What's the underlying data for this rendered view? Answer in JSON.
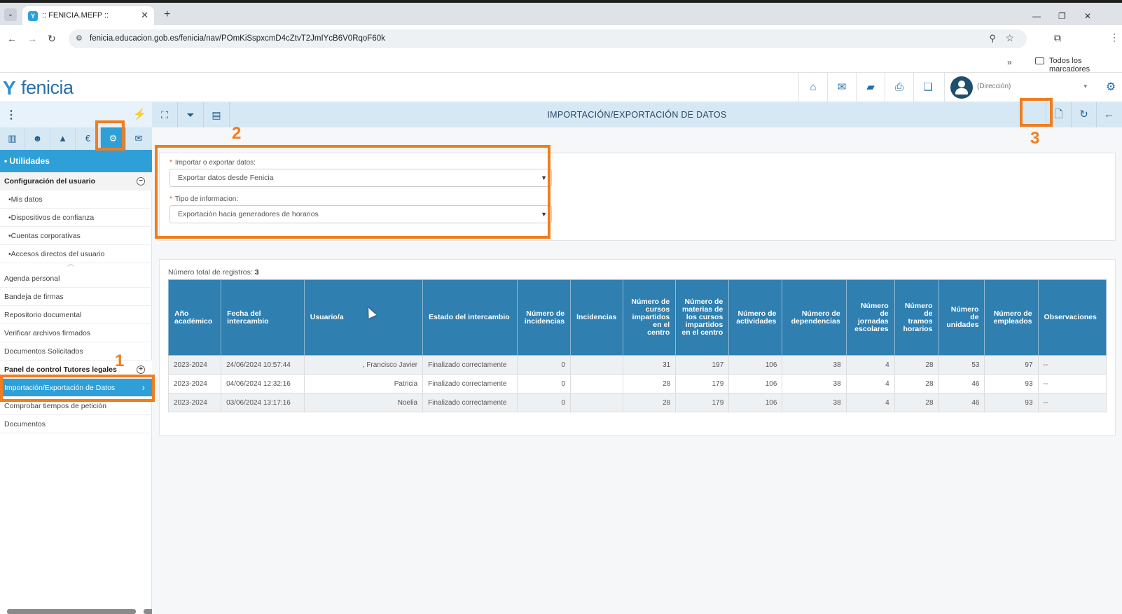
{
  "browser": {
    "tab_title": ":: FENICIA.MEFP ::",
    "tab_close": "✕",
    "new_tab": "+",
    "url": "fenicia.educacion.gob.es/fenicia/nav/POmKiSspxcmD4cZtvT2JmIYcB6V0RqoF60k",
    "bookmarks_more": "»",
    "bookmarks_label": "Todos los marcadores"
  },
  "app": {
    "logo_text": "fenicia",
    "user_name": "(Dirección)",
    "page_title": "IMPORTACIÓN/EXPORTACIÓN DE DATOS"
  },
  "sidebar": {
    "section": "• Utilidades",
    "group": "Configuración del usuario",
    "sub_items": [
      "•Mis datos",
      "•Dispositivos de confianza",
      "•Cuentas corporativas",
      "•Accesos directos del usuario"
    ],
    "items": [
      "Agenda personal",
      "Bandeja de firmas",
      "Repositorio documental",
      "Verificar archivos firmados",
      "Documentos Solicitados"
    ],
    "group2": "Panel de control Tutores legales",
    "selected": "Importación/Exportación de Datos",
    "items_after": [
      "Comprobar tiempos de petición",
      "Documentos"
    ]
  },
  "form": {
    "label1": "Importar o exportar datos:",
    "value1": "Exportar datos desde Fenicia",
    "label2": "Tipo de informacion:",
    "value2": "Exportación hacia generadores de horarios",
    "required_mark": "*"
  },
  "callouts": {
    "c1": "1",
    "c2": "2",
    "c3": "3"
  },
  "table": {
    "total_label": "Número total de registros:",
    "total_value": "3",
    "headers": [
      "Año académico",
      "Fecha del intercambio",
      "Usuario/a",
      "Estado del intercambio",
      "Número de incidencias",
      "Incidencias",
      "Número de cursos impartidos en el centro",
      "Número de materias de los cursos impartidos en el centro",
      "Número de actividades",
      "Número de dependencias",
      "Número de jornadas escolares",
      "Número de tramos horarios",
      "Número de unidades",
      "Número de empleados",
      "Observaciones"
    ],
    "rows": [
      [
        "2023-2024",
        "24/06/2024 10:57:44",
        ", Francisco Javier",
        "Finalizado correctamente",
        "0",
        "",
        "31",
        "197",
        "106",
        "38",
        "4",
        "28",
        "53",
        "97",
        "--"
      ],
      [
        "2023-2024",
        "04/06/2024 12:32:16",
        "Patricia",
        "Finalizado correctamente",
        "0",
        "",
        "28",
        "179",
        "106",
        "38",
        "4",
        "28",
        "46",
        "93",
        "--"
      ],
      [
        "2023-2024",
        "03/06/2024 13:17:16",
        "Noelia",
        "Finalizado correctamente",
        "0",
        "",
        "28",
        "179",
        "106",
        "38",
        "4",
        "28",
        "46",
        "93",
        "--"
      ]
    ]
  },
  "colors": {
    "accent": "#2f9fd8",
    "header": "#2f7fb0",
    "callout": "#f07d1e"
  }
}
